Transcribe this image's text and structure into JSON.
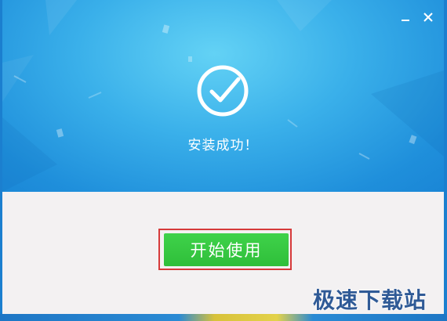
{
  "window": {
    "minimize_icon": "minimize-icon",
    "close_icon": "close-icon",
    "status_icon": "check-circle-icon",
    "status_text": "安装成功！"
  },
  "actions": {
    "start_label": "开始使用"
  },
  "watermark": {
    "text": "极速下载站"
  },
  "colors": {
    "banner": "#3ab0ea",
    "panel": "#f3f1f2",
    "button": "#38c843",
    "highlight_border": "#d63a3a",
    "watermark": "#1f4e8f"
  }
}
